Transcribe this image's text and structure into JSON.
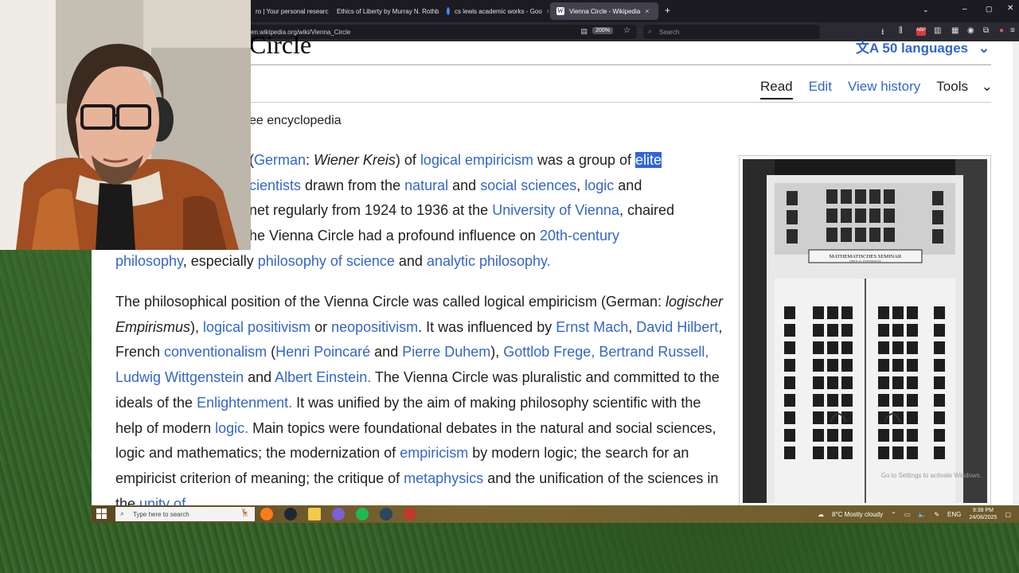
{
  "browser": {
    "tabs": [
      {
        "label": "ro | Your personal research"
      },
      {
        "label": "Ethics of Liberty by Murray N. Rothb"
      },
      {
        "label": "cs lewis academic works - Goo"
      },
      {
        "label": "Vienna Circle - Wikipedia"
      }
    ],
    "url": "en.wikipedia.org/wiki/Vienna_Circle",
    "zoom": "200%",
    "search_placeholder": "Search",
    "close_glyph": "×",
    "new_tab_glyph": "+"
  },
  "article": {
    "title_fragment": "Circle",
    "languages_label": "50 languages",
    "view_tabs": [
      {
        "label": "Read"
      },
      {
        "label": "Edit"
      },
      {
        "label": "View history"
      },
      {
        "label": "Tools"
      }
    ],
    "tagline_fragment": "ee encyclopedia",
    "p1": {
      "s1": "(",
      "l1": "German",
      "s2": ": ",
      "i1": "Wiener Kreis",
      "s3": ") of ",
      "l2": "logical empiricism",
      "s4": " was a group of ",
      "sel": "elite",
      "l3": "cientists",
      "s5": " drawn from the ",
      "l4": "natural",
      "s6": " and ",
      "l5": "social sciences",
      "s7": ", ",
      "l6": "logic",
      "s8": " and",
      "s9": "net regularly from 1924 to 1936 at the ",
      "l7": "University of Vienna",
      "s10": ", chaired",
      "s11": "he Vienna Circle had a profound influence on ",
      "l8": "20th-century",
      "l9": "philosophy",
      "s12": ", especially ",
      "l10": "philosophy of science",
      "s13": " and ",
      "l11": "analytic philosophy."
    },
    "p2": {
      "s1": "The philosophical position of the Vienna Circle was called logical empiricism (German: ",
      "i1": "logischer Empirismus",
      "s2": "), ",
      "l1": "logical positivism",
      "s3": " or ",
      "l2": "neopositivism",
      "s4": ". It was influenced by ",
      "l3": "Ernst Mach",
      "s5": ", ",
      "l4": "David Hilbert",
      "s6": ", French ",
      "l5": "conventionalism",
      "s7": " (",
      "l6": "Henri Poincaré",
      "s8": " and ",
      "l7": "Pierre Duhem",
      "s9": "), ",
      "l8": "Gottlob Frege, Bertrand Russell, Ludwig Wittgenstein",
      "s10": " and ",
      "l9": "Albert Einstein.",
      "s11": " The Vienna Circle was pluralistic and committed to the ideals of the ",
      "l10": "Enlightenment.",
      "s12": " It was unified by the aim of making philosophy scientific with the help of modern ",
      "l11": "logic.",
      "s13": " Main topics were foundational debates in the natural and social sciences, logic and mathematics; the modernization of ",
      "l12": "empiricism",
      "s14": " by modern logic; the search for an empiricist criterion of meaning; the critique of ",
      "l13": "metaphysics",
      "s15": " and the unification of the sciences in the ",
      "l14": "unity of"
    },
    "photo_sign": "MATHEMATISCHES SEMINAR",
    "photo_sign_sub": "DER K. K. UNIVERSITÄT",
    "watermark": "Go to Settings to activate Windows."
  },
  "taskbar": {
    "search_placeholder": "Type here to search",
    "weather": "8°C  Mostly cloudy",
    "language": "ENG",
    "time": "9:38 PM",
    "date": "24/08/2025"
  },
  "colors": {
    "link": "#3366cc",
    "selection": "#2c66d8",
    "browser_chrome": "#1c1b22"
  }
}
